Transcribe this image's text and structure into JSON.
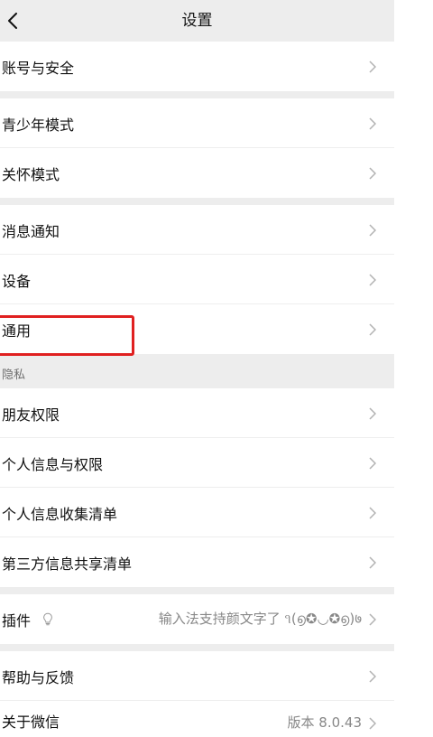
{
  "nav": {
    "title": "设置",
    "back_icon": "chevron-left-icon"
  },
  "groups": {
    "account": {
      "items": [
        {
          "label": "账号与安全"
        }
      ]
    },
    "modes": {
      "items": [
        {
          "label": "青少年模式"
        },
        {
          "label": "关怀模式"
        }
      ]
    },
    "device": {
      "items": [
        {
          "label": "消息通知"
        },
        {
          "label": "设备"
        },
        {
          "label": "通用"
        }
      ]
    },
    "privacy": {
      "section_title": "隐私",
      "items": [
        {
          "label": "朋友权限"
        },
        {
          "label": "个人信息与权限"
        },
        {
          "label": "个人信息收集清单"
        },
        {
          "label": "第三方信息共享清单"
        }
      ]
    },
    "plugins": {
      "items": [
        {
          "label": "插件",
          "icon": "lightbulb-icon",
          "value": "输入法支持颜文字了 ૧(൭✪◡✪൭)७"
        }
      ]
    },
    "support": {
      "items": [
        {
          "label": "帮助与反馈"
        },
        {
          "label": "关于微信",
          "value": "版本 8.0.43"
        }
      ]
    }
  },
  "highlight": {
    "target": "通用",
    "color": "#e02020"
  },
  "colors": {
    "nav_background": "#ededed",
    "page_background": "#ffffff",
    "secondary_text": "#888888",
    "chevron": "#b2b2b2"
  }
}
